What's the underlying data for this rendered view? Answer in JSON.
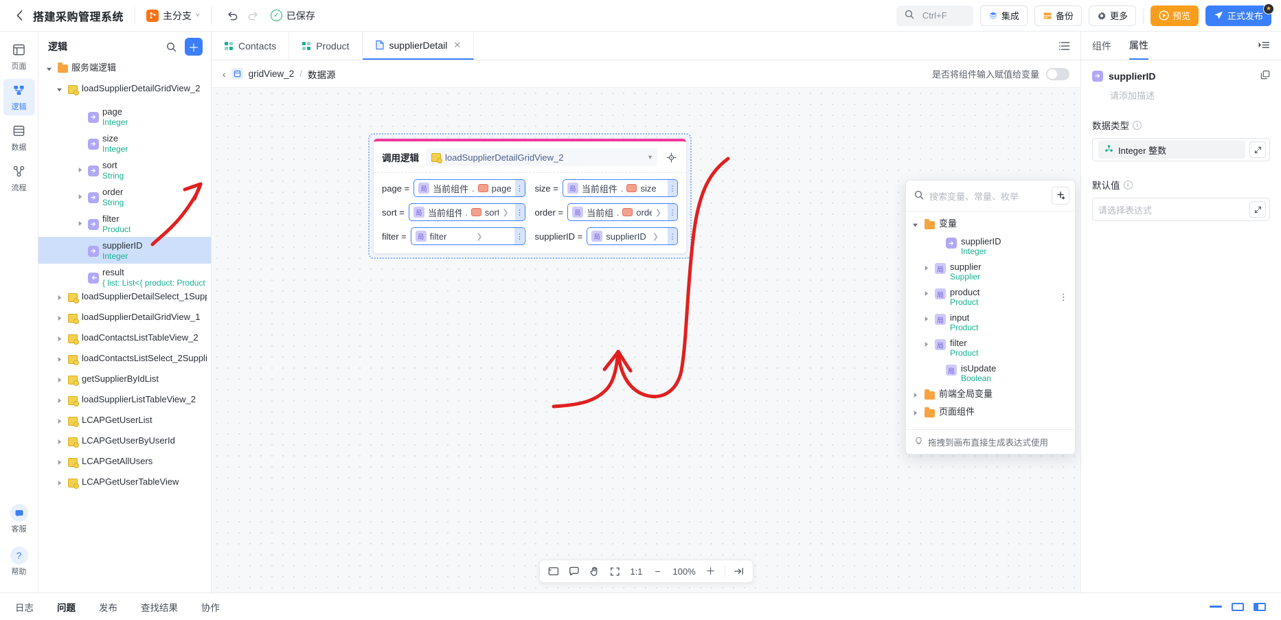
{
  "topbar": {
    "back_icon": "chevron-left-icon",
    "title": "搭建采购管理系统",
    "branch": {
      "label": "主分支",
      "icon": "branch-icon",
      "chevron": "˅"
    },
    "undo_icon": "↺",
    "redo_icon": "↻",
    "saved_label": "已保存",
    "saved_icon": "✓",
    "search_placeholder": "Ctrl+F",
    "search_icon": "search-icon",
    "buttons": [
      {
        "label": "集成",
        "icon": "layers-icon"
      },
      {
        "label": "备份",
        "icon": "backup-icon"
      },
      {
        "label": "更多",
        "icon": "gear-icon"
      }
    ],
    "preview": {
      "label": "预览",
      "icon": "play-icon"
    },
    "publish": {
      "label": "正式发布",
      "icon": "send-icon"
    }
  },
  "rail": {
    "items": [
      {
        "label": "页面",
        "icon": "page-icon",
        "active": false
      },
      {
        "label": "逻辑",
        "icon": "logic-icon",
        "active": true
      },
      {
        "label": "数据",
        "icon": "data-icon",
        "active": false
      },
      {
        "label": "流程",
        "icon": "flow-icon",
        "active": false
      }
    ],
    "bottom": [
      {
        "label": "客服",
        "icon": "headset-icon"
      },
      {
        "label": "帮助",
        "icon": "question-icon"
      }
    ]
  },
  "tree": {
    "header": {
      "title": "逻辑",
      "search_icon": "search-icon",
      "add_icon": "＋"
    },
    "nodes": [
      {
        "label": "服务端逻辑",
        "type": "",
        "icon": "folder",
        "depth": 0,
        "twisty": "open",
        "selected": false
      },
      {
        "label": "loadSupplierDetailGridView_2",
        "type": "",
        "icon": "logic",
        "depth": 1,
        "twisty": "open",
        "selected": false
      },
      {
        "label": "page",
        "type": "Integer",
        "icon": "pin-in",
        "depth": 3,
        "twisty": "",
        "selected": false
      },
      {
        "label": "size",
        "type": "Integer",
        "icon": "pin-in",
        "depth": 3,
        "twisty": "",
        "selected": false
      },
      {
        "label": "sort",
        "type": "String",
        "icon": "pin-in",
        "depth": 3,
        "twisty": "closed",
        "selected": false
      },
      {
        "label": "order",
        "type": "String",
        "icon": "pin-in",
        "depth": 3,
        "twisty": "closed",
        "selected": false
      },
      {
        "label": "filter",
        "type": "Product",
        "icon": "pin-in",
        "depth": 3,
        "twisty": "closed",
        "selected": false
      },
      {
        "label": "supplierID",
        "type": "Integer",
        "icon": "pin-in",
        "depth": 3,
        "twisty": "",
        "selected": true
      },
      {
        "label": "result",
        "type": "{ list: List<{ product: Product",
        "icon": "pin-out",
        "depth": 3,
        "twisty": "",
        "selected": false
      },
      {
        "label": "loadSupplierDetailSelect_1Supp",
        "type": "",
        "icon": "logic",
        "depth": 1,
        "twisty": "closed",
        "selected": false
      },
      {
        "label": "loadSupplierDetailGridView_1",
        "type": "",
        "icon": "logic",
        "depth": 1,
        "twisty": "closed",
        "selected": false
      },
      {
        "label": "loadContactsListTableView_2",
        "type": "",
        "icon": "logic",
        "depth": 1,
        "twisty": "closed",
        "selected": false
      },
      {
        "label": "loadContactsListSelect_2Suppli",
        "type": "",
        "icon": "logic",
        "depth": 1,
        "twisty": "closed",
        "selected": false
      },
      {
        "label": "getSupplierByIdList",
        "type": "",
        "icon": "logic",
        "depth": 1,
        "twisty": "closed",
        "selected": false
      },
      {
        "label": "loadSupplierListTableView_2",
        "type": "",
        "icon": "logic",
        "depth": 1,
        "twisty": "closed",
        "selected": false
      },
      {
        "label": "LCAPGetUserList",
        "type": "",
        "icon": "logic",
        "depth": 1,
        "twisty": "closed",
        "selected": false
      },
      {
        "label": "LCAPGetUserByUserId",
        "type": "",
        "icon": "logic",
        "depth": 1,
        "twisty": "closed",
        "selected": false
      },
      {
        "label": "LCAPGetAllUsers",
        "type": "",
        "icon": "logic",
        "depth": 1,
        "twisty": "closed",
        "selected": false
      },
      {
        "label": "LCAPGetUserTableView",
        "type": "",
        "icon": "logic",
        "depth": 1,
        "twisty": "closed",
        "selected": false
      }
    ]
  },
  "tabs": {
    "items": [
      {
        "label": "Contacts",
        "icon": "grid-icon",
        "active": false,
        "closable": false
      },
      {
        "label": "Product",
        "icon": "grid-icon",
        "active": false,
        "closable": false
      },
      {
        "label": "supplierDetail",
        "icon": "file-icon",
        "active": true,
        "closable": true
      }
    ],
    "list_icon": "list-icon"
  },
  "breadcrumb": {
    "back_icon": "‹",
    "node_icon": "component-icon",
    "node": "gridView_2",
    "separator": "/",
    "current": "数据源",
    "right_label": "是否将组件输入赋值给变量"
  },
  "node": {
    "title": "调用逻辑",
    "logic_name": "loadSupplierDetailGridView_2",
    "dropdown_icon": "▾",
    "target_icon": "crosshair-icon",
    "params": [
      {
        "name": "page",
        "badge": "局",
        "badge_label": "当前组件",
        "dot": ".",
        "prop": "page",
        "has_prop_badge": true,
        "has_arrow": false,
        "wide": false
      },
      {
        "name": "size",
        "badge": "局",
        "badge_label": "当前组件",
        "dot": ".",
        "prop": "size",
        "has_prop_badge": true,
        "has_arrow": false,
        "wide": false
      },
      {
        "name": "sort",
        "badge": "局",
        "badge_label": "当前组件",
        "dot": ".",
        "prop": "sort",
        "has_prop_badge": true,
        "has_arrow": true,
        "wide": false
      },
      {
        "name": "order",
        "badge": "局",
        "badge_label": "当前组件",
        "dot": ".",
        "prop": "order",
        "has_prop_badge": true,
        "has_arrow": true,
        "wide": false
      },
      {
        "name": "filter",
        "badge": "局",
        "badge_label": "filter",
        "dot": "",
        "prop": "",
        "has_prop_badge": false,
        "has_arrow": true,
        "wide": false
      },
      {
        "name": "supplierID",
        "badge": "局",
        "badge_label": "supplierID",
        "dot": "",
        "prop": "",
        "has_prop_badge": false,
        "has_arrow": true,
        "wide": false
      }
    ]
  },
  "varpopup": {
    "search_placeholder": "搜索变量、常量、枚举",
    "search_icon": "search-icon",
    "add_icon": "add-variable-icon",
    "rows": [
      {
        "label": "变量",
        "type": "",
        "icon": "folder",
        "depth": 0,
        "twisty": "open",
        "kebab": false
      },
      {
        "label": "supplierID",
        "type": "Integer",
        "icon": "pin-in",
        "depth": 2,
        "twisty": "",
        "kebab": false
      },
      {
        "label": "supplier",
        "type": "Supplier",
        "icon": "var",
        "depth": 1,
        "twisty": "closed",
        "kebab": false
      },
      {
        "label": "product",
        "type": "Product",
        "icon": "var",
        "depth": 1,
        "twisty": "closed",
        "kebab": true
      },
      {
        "label": "input",
        "type": "Product",
        "icon": "var",
        "depth": 1,
        "twisty": "closed",
        "kebab": false
      },
      {
        "label": "filter",
        "type": "Product",
        "icon": "var",
        "depth": 1,
        "twisty": "closed",
        "kebab": false
      },
      {
        "label": "isUpdate",
        "type": "Boolean",
        "icon": "var",
        "depth": 2,
        "twisty": "",
        "kebab": false
      },
      {
        "label": "前端全局变量",
        "type": "",
        "icon": "folder",
        "depth": 0,
        "twisty": "closed",
        "kebab": false
      },
      {
        "label": "页面组件",
        "type": "",
        "icon": "folder",
        "depth": 0,
        "twisty": "closed",
        "kebab": false
      }
    ],
    "footer_icon": "bulb-icon",
    "footer": "拖拽到画布直接生成表达式使用"
  },
  "zoombar": {
    "buttons": [
      {
        "name": "frame-icon",
        "glyph": "▭"
      },
      {
        "name": "comment-icon",
        "glyph": "🗨"
      },
      {
        "name": "hand-icon",
        "glyph": "✋"
      },
      {
        "name": "fit-icon",
        "glyph": "⤢"
      }
    ],
    "ratio": "1:1",
    "minus": "−",
    "level": "100%",
    "plus": "＋",
    "collapse_icon": "→|"
  },
  "rightpanel": {
    "tabs": [
      {
        "label": "组件",
        "active": false
      },
      {
        "label": "属性",
        "active": true
      }
    ],
    "menu_icon": "panel-menu-icon",
    "name": "supplierID",
    "name_icon": "pin-in-icon",
    "copy_icon": "copy-icon",
    "description_placeholder": "请添加描述",
    "datatype": {
      "label": "数据类型",
      "value": "Integer 整数",
      "value_icon": "type-icon",
      "expand_icon": "expand-icon"
    },
    "defaultvalue": {
      "label": "默认值",
      "placeholder": "请选择表达式",
      "expand_icon": "expand-icon"
    }
  },
  "bottombar": {
    "items": [
      {
        "label": "日志",
        "active": false
      },
      {
        "label": "问题",
        "active": true
      },
      {
        "label": "发布",
        "active": false
      },
      {
        "label": "查找结果",
        "active": false
      },
      {
        "label": "协作",
        "active": false
      }
    ],
    "window_icons": [
      "minimize-icon",
      "restore-icon",
      "split-icon"
    ]
  },
  "colors": {
    "accent": "#3b7ffb",
    "preview": "#f99d1c",
    "node_top": "#f0399a",
    "type_text": "#17b092",
    "annotation": "#e02020"
  }
}
